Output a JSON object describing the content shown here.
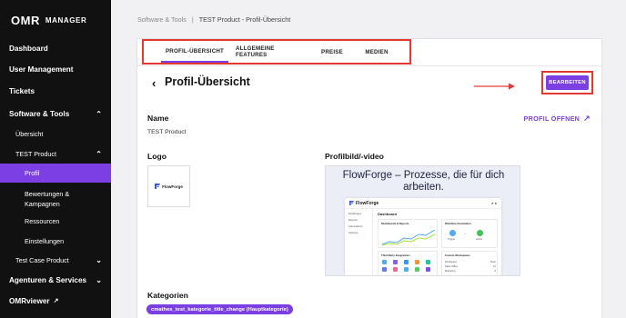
{
  "sidebar": {
    "logo": {
      "brand": "OMR",
      "product": "MANAGER"
    },
    "items": [
      {
        "label": "Dashboard"
      },
      {
        "label": "User Management"
      },
      {
        "label": "Tickets"
      },
      {
        "label": "Software & Tools"
      },
      {
        "label": "Übersicht"
      },
      {
        "label": "TEST Product"
      },
      {
        "label": "Profil"
      },
      {
        "label": "Bewertungen &"
      },
      {
        "label": "Kampagnen"
      },
      {
        "label": "Ressourcen"
      },
      {
        "label": "Einstellungen"
      },
      {
        "label": "Test Case Product"
      },
      {
        "label": "Agenturen & Services"
      },
      {
        "label": "OMRviewer"
      }
    ]
  },
  "breadcrumb": {
    "parent": "Software & Tools",
    "separator": "|",
    "current": "TEST Product - Profil-Übersicht"
  },
  "tabs": [
    {
      "label": "PROFIL-ÜBERSICHT"
    },
    {
      "label": "ALLGEMEINE FEATURES"
    },
    {
      "label": "PREISE"
    },
    {
      "label": "MEDIEN"
    }
  ],
  "header": {
    "back_icon": "chevron-left-icon",
    "title": "Profil-Übersicht",
    "edit_label": "BEARBEITEN"
  },
  "name_section": {
    "label": "Name",
    "value": "TEST Product",
    "open_profile": "PROFIL ÖFFNEN"
  },
  "logo_section": {
    "label": "Logo",
    "brand_text": "FlowForge"
  },
  "media_section": {
    "label": "Profilbild/-video",
    "headline_line1": "FlowForge – Prozesse, die für dich",
    "headline_line2": "arbeiten.",
    "app_name": "FlowForge",
    "app_page": "Dashboard",
    "nav": [
      "Dashboard",
      "Reports",
      "Automations",
      "Settings"
    ],
    "cards": [
      "Dashboards & Reports",
      "Workflow Automation",
      "Third-Party Integrations",
      "Custom Workspaces"
    ],
    "flow_nodes": [
      "Trigger",
      "Action"
    ],
    "workspaces": [
      "Workspace",
      "Sales Office",
      "Marketing"
    ],
    "workspace_counts": [
      "Team",
      "10",
      "8"
    ]
  },
  "categories": {
    "label": "Kategorien",
    "chip": "cmathes_test_kategorie_title_change (Hauptkategorie)"
  },
  "colors": {
    "accent": "#7b3fe4",
    "annotation": "#e23a32",
    "sidebar_bg": "#111111"
  }
}
